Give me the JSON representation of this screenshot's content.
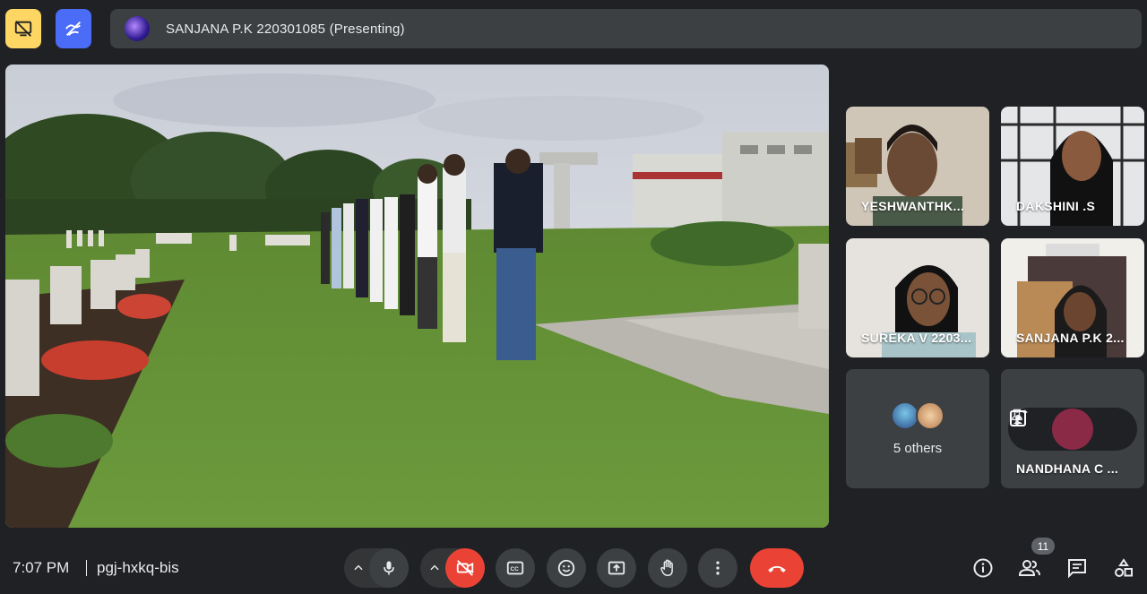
{
  "top": {
    "presenting_text": "SANJANA P.K 220301085 (Presenting)",
    "left_icon_1": "screen-share-off-icon",
    "left_icon_2": "annotate-icon"
  },
  "participants": [
    {
      "name": "YESHWANTHK..."
    },
    {
      "name": "DAKSHINI .S"
    },
    {
      "name": "SUREKA V 2203..."
    },
    {
      "name": "SANJANA P.K 2..."
    },
    {
      "name": "5 others"
    },
    {
      "name": "NANDHANA C ..."
    }
  ],
  "bottom": {
    "time": "7:07 PM",
    "meeting_code": "pgj-hxkq-bis",
    "participant_count": "11"
  },
  "colors": {
    "background": "#202124",
    "tile": "#3c4043",
    "danger": "#ea4335",
    "accent_yellow": "#fdd663",
    "accent_blue": "#4a6cf7"
  }
}
